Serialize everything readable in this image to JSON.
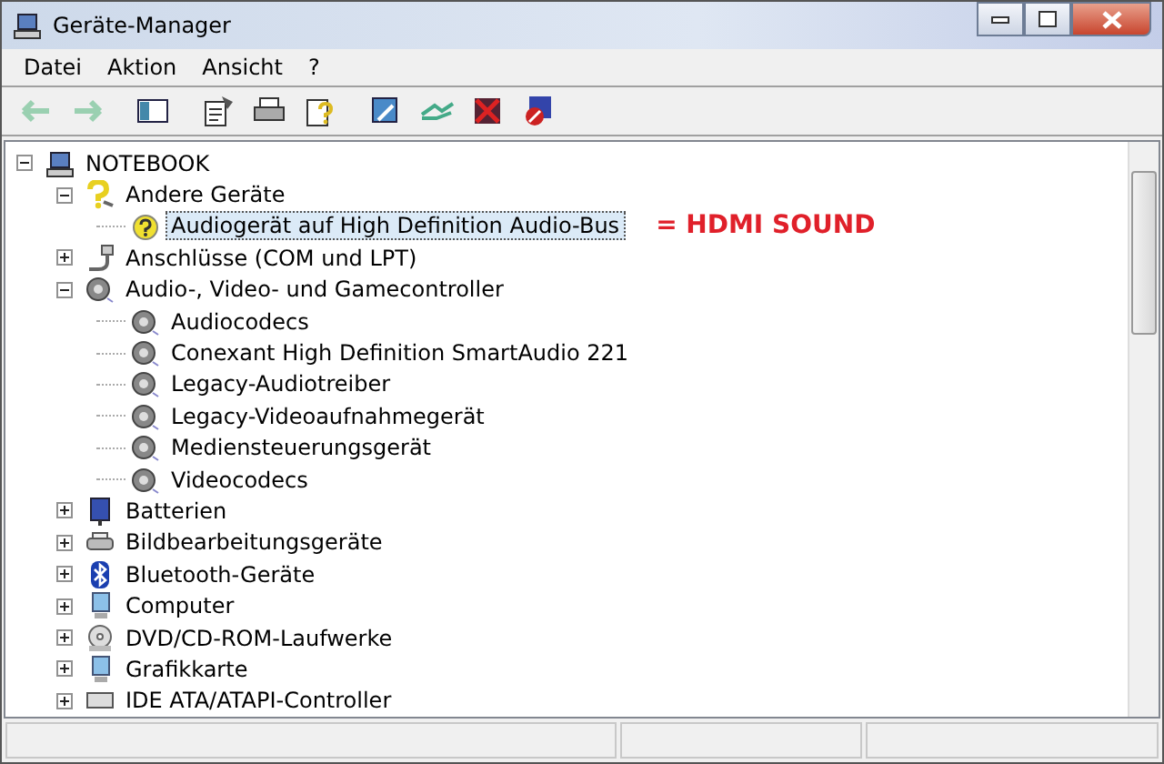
{
  "window": {
    "title": "Geräte-Manager"
  },
  "menu": [
    "Datei",
    "Aktion",
    "Ansicht",
    "?"
  ],
  "toolbar": [
    {
      "kind": "back",
      "disabled": true
    },
    {
      "kind": "forward",
      "disabled": true
    },
    {
      "kind": "tree",
      "disabled": false
    },
    {
      "kind": "properties",
      "disabled": false
    },
    {
      "kind": "print",
      "disabled": false
    },
    {
      "kind": "help",
      "disabled": false
    },
    {
      "kind": "scan",
      "disabled": false
    },
    {
      "kind": "update",
      "disabled": false
    },
    {
      "kind": "uninstall",
      "disabled": false
    },
    {
      "kind": "disable",
      "disabled": false
    }
  ],
  "tree": [
    {
      "label": "NOTEBOOK",
      "kind": "computer",
      "expanded": true,
      "selected": false,
      "children": [
        {
          "label": "Andere Geräte",
          "kind": "unknown",
          "expanded": true,
          "selected": false,
          "children": [
            {
              "label": "Audiogerät auf High Definition Audio-Bus",
              "kind": "unknown-device",
              "selected": true,
              "annotation": "= HDMI SOUND"
            }
          ]
        },
        {
          "label": "Anschlüsse (COM und LPT)",
          "kind": "port",
          "expanded": false,
          "selected": false
        },
        {
          "label": "Audio-, Video- und Gamecontroller",
          "kind": "speaker",
          "expanded": true,
          "selected": false,
          "children": [
            {
              "label": "Audiocodecs",
              "kind": "speaker",
              "selected": false
            },
            {
              "label": "Conexant High Definition SmartAudio 221",
              "kind": "speaker",
              "selected": false
            },
            {
              "label": "Legacy-Audiotreiber",
              "kind": "speaker",
              "selected": false
            },
            {
              "label": "Legacy-Videoaufnahmegerät",
              "kind": "speaker",
              "selected": false
            },
            {
              "label": "Mediensteuerungsgerät",
              "kind": "speaker",
              "selected": false
            },
            {
              "label": "Videocodecs",
              "kind": "speaker",
              "selected": false
            }
          ]
        },
        {
          "label": "Batterien",
          "kind": "battery",
          "expanded": false,
          "selected": false
        },
        {
          "label": "Bildbearbeitungsgeräte",
          "kind": "imaging",
          "expanded": false,
          "selected": false
        },
        {
          "label": "Bluetooth-Geräte",
          "kind": "bluetooth",
          "expanded": false,
          "selected": false
        },
        {
          "label": "Computer",
          "kind": "monitor",
          "expanded": false,
          "selected": false
        },
        {
          "label": "DVD/CD-ROM-Laufwerke",
          "kind": "disc",
          "expanded": false,
          "selected": false
        },
        {
          "label": "Grafikkarte",
          "kind": "monitor",
          "expanded": false,
          "selected": false
        },
        {
          "label": "IDE ATA/ATAPI-Controller",
          "kind": "ide",
          "expanded": false,
          "selected": false
        }
      ]
    }
  ]
}
